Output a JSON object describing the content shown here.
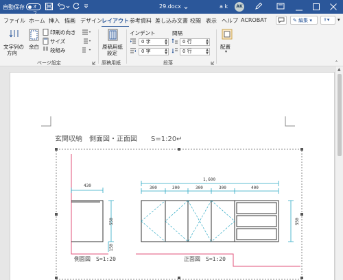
{
  "titlebar": {
    "autosave_label": "自動保存",
    "autosave_state": "オフ",
    "filename": "29.docx",
    "user_name": "a k",
    "user_initials": "AK"
  },
  "tabs": [
    {
      "label": "ファイル"
    },
    {
      "label": "ホーム"
    },
    {
      "label": "挿入"
    },
    {
      "label": "描画"
    },
    {
      "label": "デザイン"
    },
    {
      "label": "レイアウト"
    },
    {
      "label": "参考資料"
    },
    {
      "label": "差し込み文書"
    },
    {
      "label": "校閲"
    },
    {
      "label": "表示"
    },
    {
      "label": "ヘルプ"
    },
    {
      "label": "ACROBAT"
    }
  ],
  "tab_actions": {
    "edit_label": "編集"
  },
  "ribbon": {
    "page_setup": {
      "text_direction": "文字列の",
      "text_direction2": "方向",
      "margins": "余白",
      "orientation": "印刷の向き",
      "size": "サイズ",
      "columns": "段組み",
      "group_label": "ページ設定"
    },
    "manuscript": {
      "button": "原稿用紙",
      "button2": "設定",
      "group_label": "原稿用紙"
    },
    "paragraph": {
      "indent_label": "インデント",
      "spacing_label": "間隔",
      "indent_left": "0 字",
      "indent_right": "0 字",
      "space_before": "0 行",
      "space_after": "0 行",
      "group_label": "段落"
    },
    "arrange": {
      "label": "配置"
    }
  },
  "document": {
    "heading": "玄関収納　側面図・正面図　　S=1:20↵",
    "drawing": {
      "dim_side_width": "430",
      "dim_total_width": "1,600",
      "dim_segments": [
        "300",
        "300",
        "300",
        "300",
        "400"
      ],
      "dim_height_upper": "550",
      "dim_height_lower": "150",
      "dim_front_height": "550",
      "side_label": "側面図　S=1:20",
      "front_label": "正面図　S=1:20"
    }
  }
}
